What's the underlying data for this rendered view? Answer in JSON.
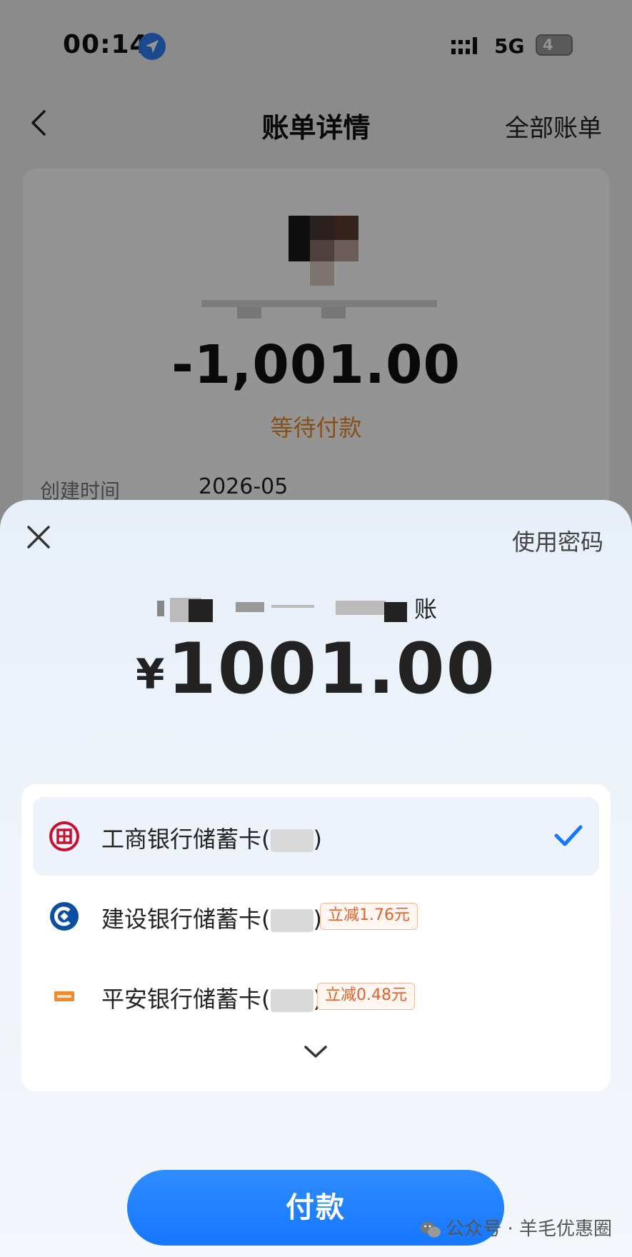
{
  "status_bar": {
    "time": "00:14",
    "network": "5G",
    "battery": "4"
  },
  "nav": {
    "title": "账单详情",
    "right_link": "全部账单"
  },
  "bill": {
    "amount": "-1,001.00",
    "status": "等待付款",
    "created_label": "创建时间",
    "created_value": "2026-05"
  },
  "sheet": {
    "password_link": "使用密码",
    "payee_suffix": "账",
    "currency": "¥",
    "amount": "1001.00",
    "methods": [
      {
        "name": "工商银行储蓄卡(",
        "close": ")",
        "discount": "",
        "selected": true,
        "icon": "icbc-icon"
      },
      {
        "name": "建设银行储蓄卡(",
        "close": ")",
        "discount": "立减1.76元",
        "selected": false,
        "icon": "ccb-icon"
      },
      {
        "name": "平安银行储蓄卡(",
        "close": ")",
        "discount": "立减0.48元",
        "selected": false,
        "icon": "pingan-icon"
      }
    ],
    "pay_button": "付款"
  },
  "watermark": {
    "text": "公众号 · 羊毛优惠圈"
  },
  "colors": {
    "accent": "#1677ff",
    "pending": "#e8892b",
    "discount": "#e0622f"
  }
}
